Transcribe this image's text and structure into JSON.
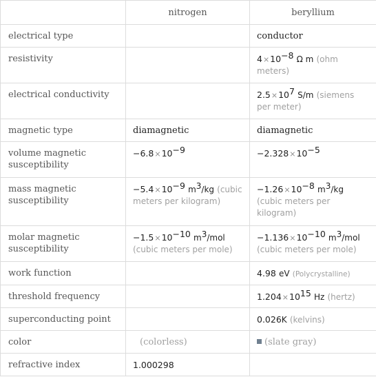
{
  "header": {
    "col1": "",
    "col2": "nitrogen",
    "col3": "beryllium"
  },
  "rows": {
    "electrical_type": {
      "label": "electrical type",
      "nitrogen": "",
      "beryllium": "conductor"
    },
    "resistivity": {
      "label": "resistivity",
      "beryllium": {
        "mantissa": "4",
        "times": "×",
        "base": "10",
        "exp": "−8",
        "unit": "Ω m",
        "note": "(ohm meters)"
      }
    },
    "electrical_conductivity": {
      "label": "electrical conductivity",
      "beryllium": {
        "mantissa": "2.5",
        "times": "×",
        "base": "10",
        "exp": "7",
        "unit": "S/m",
        "note": "(siemens per meter)"
      }
    },
    "magnetic_type": {
      "label": "magnetic type",
      "nitrogen": "diamagnetic",
      "beryllium": "diamagnetic"
    },
    "volume_magnetic_susceptibility": {
      "label": "volume magnetic susceptibility",
      "nitrogen": {
        "mantissa": "−6.8",
        "times": "×",
        "base": "10",
        "exp": "−9"
      },
      "beryllium": {
        "mantissa": "−2.328",
        "times": "×",
        "base": "10",
        "exp": "−5"
      }
    },
    "mass_magnetic_susceptibility": {
      "label": "mass magnetic susceptibility",
      "nitrogen": {
        "mantissa": "−5.4",
        "times": "×",
        "base": "10",
        "exp": "−9",
        "unit_base": "m",
        "unit_exp": "3",
        "unit_rest": "/kg",
        "note": "(cubic meters per kilogram)"
      },
      "beryllium": {
        "mantissa": "−1.26",
        "times": "×",
        "base": "10",
        "exp": "−8",
        "unit_base": "m",
        "unit_exp": "3",
        "unit_rest": "/kg",
        "note": "(cubic meters per kilogram)"
      }
    },
    "molar_magnetic_susceptibility": {
      "label": "molar magnetic susceptibility",
      "nitrogen": {
        "mantissa": "−1.5",
        "times": "×",
        "base": "10",
        "exp": "−10",
        "unit_base": "m",
        "unit_exp": "3",
        "unit_rest": "/mol",
        "note": "(cubic meters per mole)"
      },
      "beryllium": {
        "mantissa": "−1.136",
        "times": "×",
        "base": "10",
        "exp": "−10",
        "unit_base": "m",
        "unit_exp": "3",
        "unit_rest": "/mol",
        "note": "(cubic meters per mole)"
      }
    },
    "work_function": {
      "label": "work function",
      "beryllium": {
        "value": "4.98",
        "unit": "eV",
        "note": "(Polycrystalline)"
      }
    },
    "threshold_frequency": {
      "label": "threshold frequency",
      "beryllium": {
        "mantissa": "1.204",
        "times": "×",
        "base": "10",
        "exp": "15",
        "unit": "Hz",
        "note": "(hertz)"
      }
    },
    "superconducting_point": {
      "label": "superconducting point",
      "beryllium": {
        "value": "0.026",
        "unit": "K",
        "note": "(kelvins)"
      }
    },
    "color": {
      "label": "color",
      "nitrogen": {
        "note": "(colorless)"
      },
      "beryllium": {
        "swatch": "#708090",
        "note": "(slate gray)"
      }
    },
    "refractive_index": {
      "label": "refractive index",
      "nitrogen": "1.000298",
      "beryllium": ""
    }
  }
}
